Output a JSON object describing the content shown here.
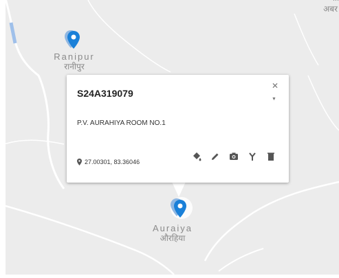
{
  "map": {
    "colors": {
      "background": "#ececec",
      "road": "#ffffff",
      "river": "#9fc0ea",
      "marker": "#1a80d8"
    },
    "places": [
      {
        "name_en": "Ranipur",
        "name_hi": "रानीपुर"
      },
      {
        "name_en": "Auraiya",
        "name_hi": "औरहिया"
      }
    ],
    "corner_label": {
      "line1": "...",
      "line2": "अबर"
    }
  },
  "popup": {
    "title": "S24A319079",
    "address": "P.V. AURAHIYA ROOM NO.1",
    "coordinates": "27.00301, 83.36046",
    "icons": [
      "pin-icon",
      "paint-bucket-icon",
      "pencil-icon",
      "camera-icon",
      "fork-icon",
      "trash-icon",
      "close-icon"
    ]
  }
}
